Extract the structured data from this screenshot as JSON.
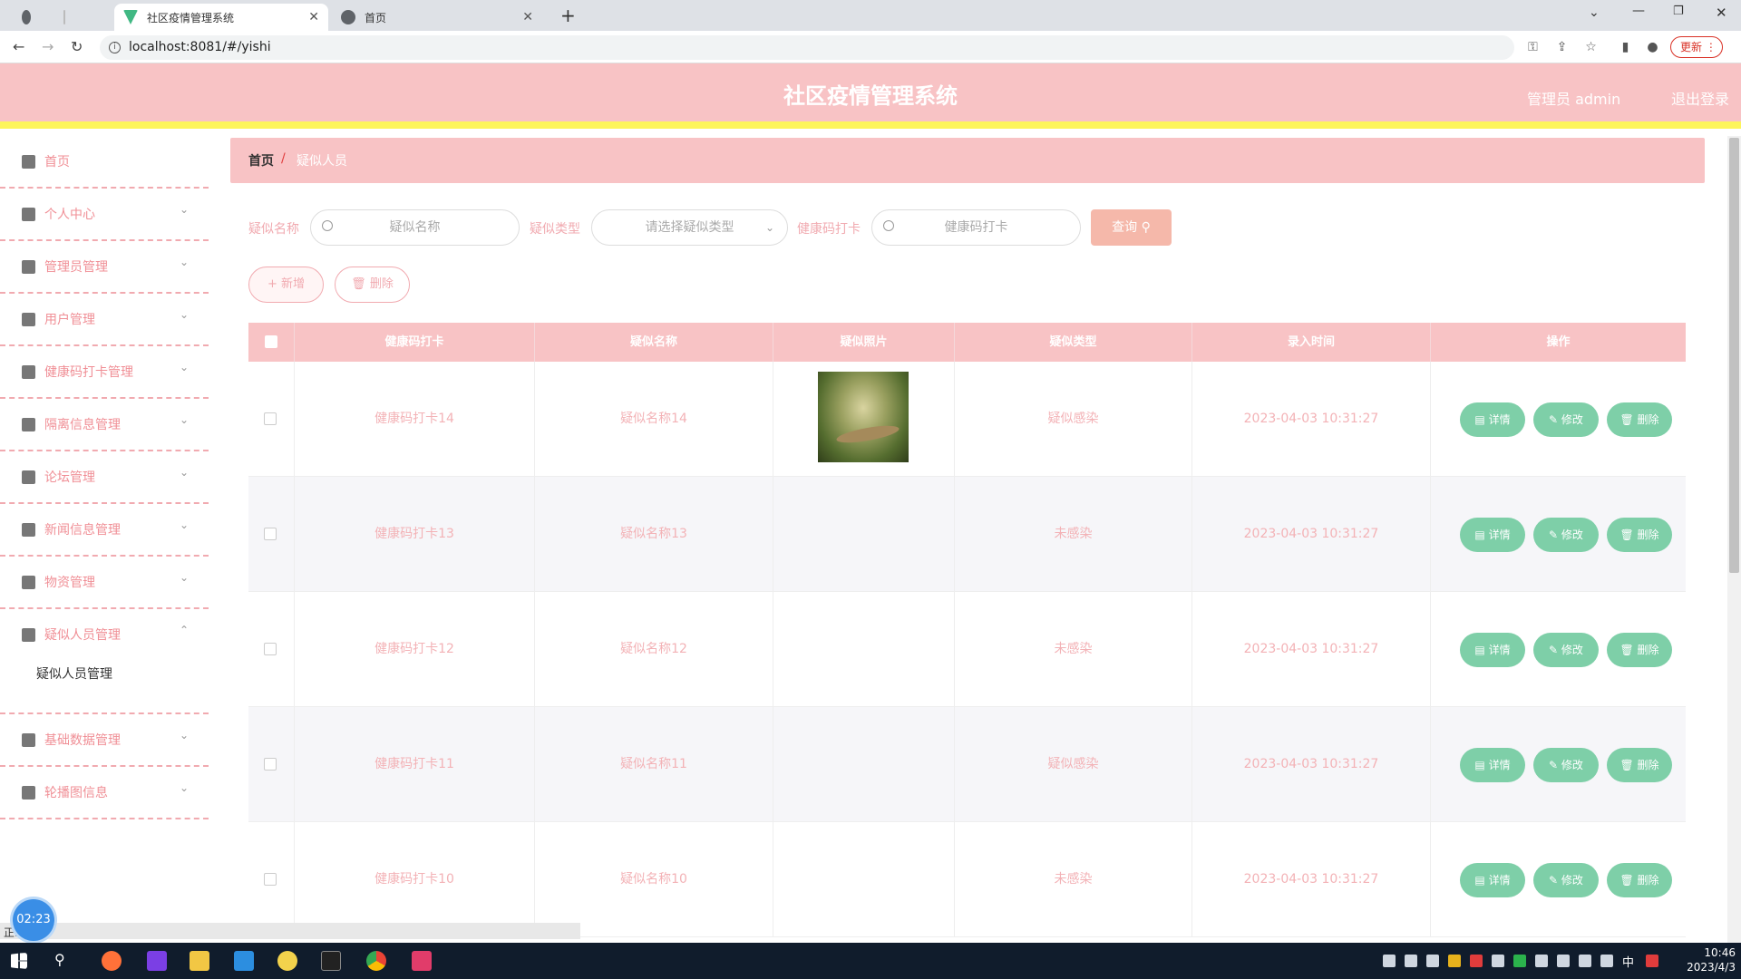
{
  "browser": {
    "tabs": [
      {
        "label": "社区疫情管理系统",
        "active": true
      },
      {
        "label": "首页",
        "active": false
      }
    ],
    "url": "localhost:8081/#/yishi",
    "update_label": "更新"
  },
  "header": {
    "title": "社区疫情管理系统",
    "admin_label": "管理员 admin",
    "logout_label": "退出登录"
  },
  "sidebar": {
    "items": [
      {
        "label": "首页",
        "icon": "home-icon"
      },
      {
        "label": "个人中心",
        "icon": "user-icon"
      },
      {
        "label": "管理员管理",
        "icon": "settings-icon"
      },
      {
        "label": "用户管理",
        "icon": "sliders-icon"
      },
      {
        "label": "健康码打卡管理",
        "icon": "briefcase-icon"
      },
      {
        "label": "隔离信息管理",
        "icon": "grid-icon"
      },
      {
        "label": "论坛管理",
        "icon": "forum-icon"
      },
      {
        "label": "新闻信息管理",
        "icon": "fullscreen-icon"
      },
      {
        "label": "物资管理",
        "icon": "send-icon"
      },
      {
        "label": "疑似人员管理",
        "icon": "camera-icon"
      },
      {
        "label": "基础数据管理",
        "icon": "monitor-icon"
      },
      {
        "label": "轮播图信息",
        "icon": "clipboard-icon"
      }
    ],
    "sub_item": "疑似人员管理"
  },
  "breadcrumb": {
    "home": "首页",
    "separator": "/",
    "current": "疑似人员"
  },
  "search": {
    "name_label": "疑似名称",
    "name_placeholder": "疑似名称",
    "type_label": "疑似类型",
    "type_placeholder": "请选择疑似类型",
    "health_label": "健康码打卡",
    "health_placeholder": "健康码打卡",
    "query_label": "查询"
  },
  "actions": {
    "add_label": "+ 新增",
    "delete_label": "删除"
  },
  "table": {
    "headers": [
      "健康码打卡",
      "疑似名称",
      "疑似照片",
      "疑似类型",
      "录入时间",
      "操作"
    ],
    "rows": [
      {
        "health": "健康码打卡14",
        "name": "疑似名称14",
        "has_photo": true,
        "type": "疑似感染",
        "time": "2023-04-03 10:31:27"
      },
      {
        "health": "健康码打卡13",
        "name": "疑似名称13",
        "has_photo": false,
        "type": "未感染",
        "time": "2023-04-03 10:31:27"
      },
      {
        "health": "健康码打卡12",
        "name": "疑似名称12",
        "has_photo": false,
        "type": "未感染",
        "time": "2023-04-03 10:31:27"
      },
      {
        "health": "健康码打卡11",
        "name": "疑似名称11",
        "has_photo": false,
        "type": "疑似感染",
        "time": "2023-04-03 10:31:27"
      },
      {
        "health": "健康码打卡10",
        "name": "疑似名称10",
        "has_photo": false,
        "type": "未感染",
        "time": "2023-04-03 10:31:27"
      }
    ],
    "row_actions": {
      "detail": "详情",
      "edit": "修改",
      "delete": "删除"
    }
  },
  "timer": "02:23",
  "status": "正...",
  "clock": {
    "time": "10:46",
    "date": "2023/4/3"
  },
  "colors": {
    "header_bg": "#f8c3c5",
    "accent_yellow": "#fdf55a",
    "action_green": "#7ecfa8"
  }
}
